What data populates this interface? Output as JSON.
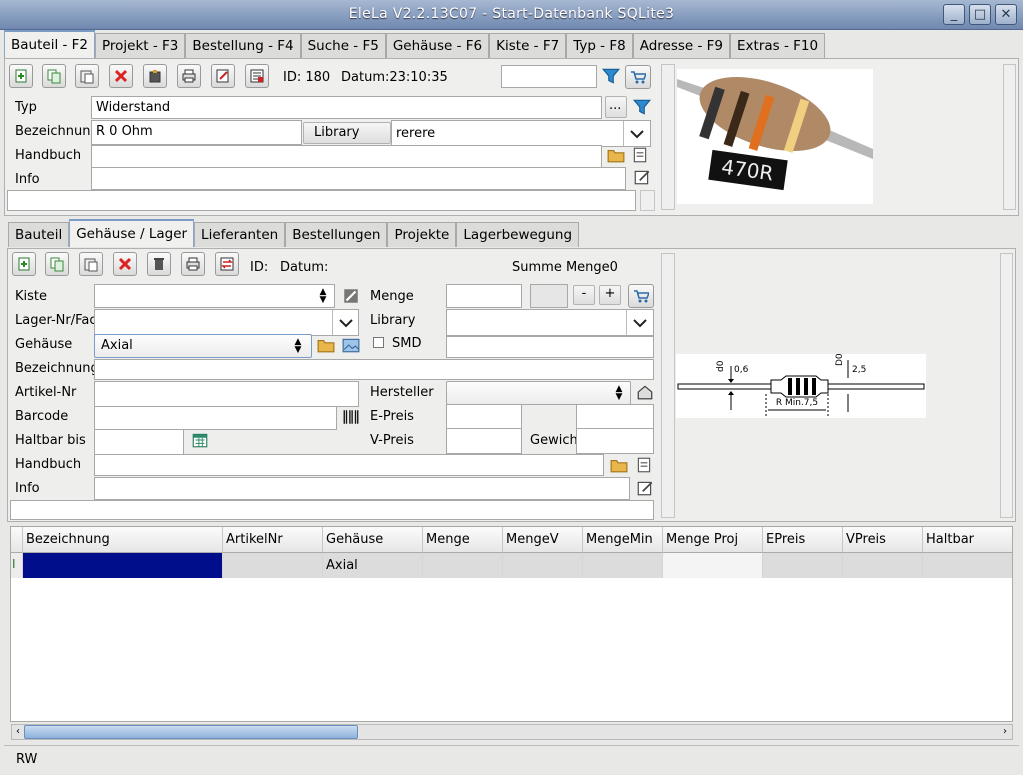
{
  "window": {
    "title": "EleLa V2.2.13C07  - Start-Datenbank SQLite3",
    "btn_min": "_",
    "btn_max": "□",
    "btn_close": "✕"
  },
  "main_tabs": [
    "Bauteil - F2",
    "Projekt - F3",
    "Bestellung - F4",
    "Suche - F5",
    "Gehäuse - F6",
    "Kiste - F7",
    "Typ - F8",
    "Adresse - F9",
    "Extras - F10"
  ],
  "bauteil": {
    "id_label": "ID: 180",
    "datum_label": "Datum:23:10:35",
    "search_value": "",
    "typ_label": "Typ",
    "typ_value": "Widerstand",
    "bezeichnung_label": "Bezeichnung",
    "bezeichnung_value": "R 0 Ohm",
    "library_label": "Library",
    "library_value": "rerere",
    "handbuch_label": "Handbuch",
    "handbuch_value": "",
    "info_label": "Info",
    "info_value": "",
    "ellipsis": "...",
    "image_text": "470R"
  },
  "sub_tabs": [
    "Bauteil",
    "Gehäuse / Lager",
    "Lieferanten",
    "Bestellungen",
    "Projekte",
    "Lagerbewegung"
  ],
  "lager": {
    "id_label": "ID:",
    "datum_label": "Datum:",
    "summe_label": "Summe Menge0",
    "kiste_label": "Kiste",
    "menge_label": "Menge",
    "minus": "-",
    "plus": "+",
    "lagernr_label": "Lager-Nr/Fach",
    "library_label": "Library",
    "gehaeuse_label": "Gehäuse",
    "gehaeuse_value": "Axial",
    "smd_label": "SMD",
    "bezeichnung_label": "Bezeichnung",
    "artikelnr_label": "Artikel-Nr",
    "hersteller_label": "Hersteller",
    "barcode_label": "Barcode",
    "epreis_label": "E-Preis",
    "haltbar_label": "Haltbar bis",
    "vpreis_label": "V-Preis",
    "gewicht_label": "Gewicht",
    "handbuch_label": "Handbuch",
    "info_label": "Info",
    "diagram": {
      "d1": "d0",
      "v1": "0,6",
      "d2": "D0",
      "v2": "2,5",
      "len": "R Min.7,5"
    }
  },
  "grid": {
    "columns": [
      "Bezeichnung",
      "ArtikelNr",
      "Gehäuse",
      "Menge",
      "MengeV",
      "MengeMin",
      "Menge Proj",
      "EPreis",
      "VPreis",
      "Haltbar"
    ],
    "rows": [
      {
        "indicator": "I",
        "Bezeichnung": "",
        "ArtikelNr": "",
        "Gehaeuse": "Axial",
        "Menge": "",
        "MengeV": "",
        "MengeMin": "",
        "MengeProj": "",
        "EPreis": "",
        "VPreis": "",
        "Haltbar": ""
      }
    ]
  },
  "statusbar": {
    "text": "RW"
  }
}
